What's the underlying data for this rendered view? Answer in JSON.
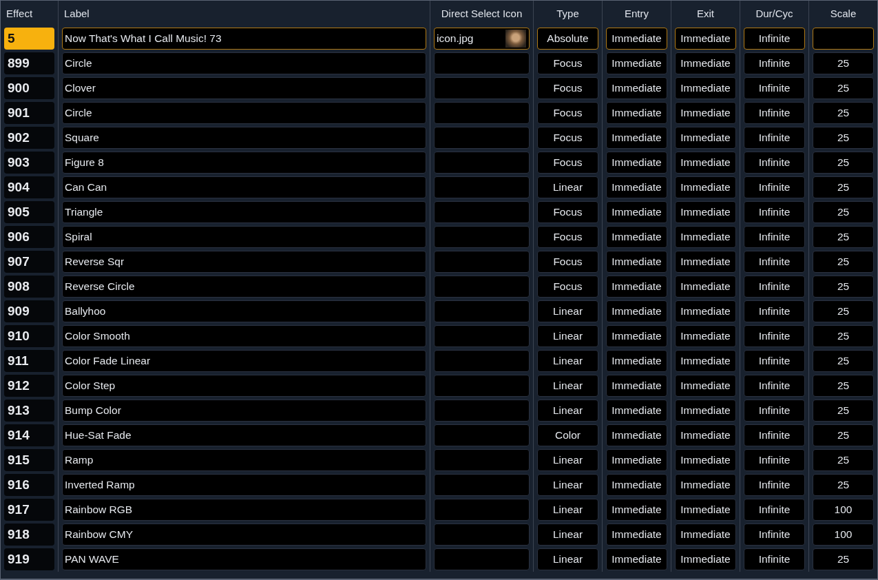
{
  "columns": [
    "Effect",
    "Label",
    "Direct Select Icon",
    "Type",
    "Entry",
    "Exit",
    "Dur/Cyc",
    "Scale"
  ],
  "rows": [
    {
      "effect": "5",
      "label": "Now That's What I Call Music! 73",
      "icon": {
        "file": "icon.jpg"
      },
      "type": "Absolute",
      "entry": "Immediate",
      "exit": "Immediate",
      "duration": "Infinite",
      "selected": true
    },
    {
      "effect": "899",
      "label": "Circle",
      "type": "Focus",
      "entry": "Immediate",
      "exit": "Immediate",
      "duration": "Infinite",
      "scale": "25",
      "selected": false
    },
    {
      "effect": "900",
      "label": "Clover",
      "type": "Focus",
      "entry": "Immediate",
      "exit": "Immediate",
      "duration": "Infinite",
      "scale": "25",
      "selected": false
    },
    {
      "effect": "901",
      "label": "Circle",
      "type": "Focus",
      "entry": "Immediate",
      "exit": "Immediate",
      "duration": "Infinite",
      "scale": "25",
      "selected": false
    },
    {
      "effect": "902",
      "label": "Square",
      "type": "Focus",
      "entry": "Immediate",
      "exit": "Immediate",
      "duration": "Infinite",
      "scale": "25",
      "selected": false
    },
    {
      "effect": "903",
      "label": "Figure 8",
      "type": "Focus",
      "entry": "Immediate",
      "exit": "Immediate",
      "duration": "Infinite",
      "scale": "25",
      "selected": false
    },
    {
      "effect": "904",
      "label": "Can Can",
      "type": "Linear",
      "entry": "Immediate",
      "exit": "Immediate",
      "duration": "Infinite",
      "scale": "25",
      "selected": false
    },
    {
      "effect": "905",
      "label": "Triangle",
      "type": "Focus",
      "entry": "Immediate",
      "exit": "Immediate",
      "duration": "Infinite",
      "scale": "25",
      "selected": false
    },
    {
      "effect": "906",
      "label": "Spiral",
      "type": "Focus",
      "entry": "Immediate",
      "exit": "Immediate",
      "duration": "Infinite",
      "scale": "25",
      "selected": false
    },
    {
      "effect": "907",
      "label": "Reverse Sqr",
      "type": "Focus",
      "entry": "Immediate",
      "exit": "Immediate",
      "duration": "Infinite",
      "scale": "25",
      "selected": false
    },
    {
      "effect": "908",
      "label": "Reverse Circle",
      "type": "Focus",
      "entry": "Immediate",
      "exit": "Immediate",
      "duration": "Infinite",
      "scale": "25",
      "selected": false
    },
    {
      "effect": "909",
      "label": "Ballyhoo",
      "type": "Linear",
      "entry": "Immediate",
      "exit": "Immediate",
      "duration": "Infinite",
      "scale": "25",
      "selected": false
    },
    {
      "effect": "910",
      "label": "Color Smooth",
      "type": "Linear",
      "entry": "Immediate",
      "exit": "Immediate",
      "duration": "Infinite",
      "scale": "25",
      "selected": false
    },
    {
      "effect": "911",
      "label": "Color Fade Linear",
      "type": "Linear",
      "entry": "Immediate",
      "exit": "Immediate",
      "duration": "Infinite",
      "scale": "25",
      "selected": false
    },
    {
      "effect": "912",
      "label": "Color Step",
      "type": "Linear",
      "entry": "Immediate",
      "exit": "Immediate",
      "duration": "Infinite",
      "scale": "25",
      "selected": false
    },
    {
      "effect": "913",
      "label": "Bump Color",
      "type": "Linear",
      "entry": "Immediate",
      "exit": "Immediate",
      "duration": "Infinite",
      "scale": "25",
      "selected": false
    },
    {
      "effect": "914",
      "label": "Hue-Sat Fade",
      "type": "Color",
      "entry": "Immediate",
      "exit": "Immediate",
      "duration": "Infinite",
      "scale": "25",
      "selected": false
    },
    {
      "effect": "915",
      "label": "Ramp",
      "type": "Linear",
      "entry": "Immediate",
      "exit": "Immediate",
      "duration": "Infinite",
      "scale": "25",
      "selected": false
    },
    {
      "effect": "916",
      "label": "Inverted Ramp",
      "type": "Linear",
      "entry": "Immediate",
      "exit": "Immediate",
      "duration": "Infinite",
      "scale": "25",
      "selected": false
    },
    {
      "effect": "917",
      "label": "Rainbow RGB",
      "type": "Linear",
      "entry": "Immediate",
      "exit": "Immediate",
      "duration": "Infinite",
      "scale": "100",
      "selected": false
    },
    {
      "effect": "918",
      "label": "Rainbow CMY",
      "type": "Linear",
      "entry": "Immediate",
      "exit": "Immediate",
      "duration": "Infinite",
      "scale": "100",
      "selected": false
    },
    {
      "effect": "919",
      "label": "PAN WAVE",
      "type": "Linear",
      "entry": "Immediate",
      "exit": "Immediate",
      "duration": "Infinite",
      "scale": "25",
      "selected": false
    }
  ]
}
